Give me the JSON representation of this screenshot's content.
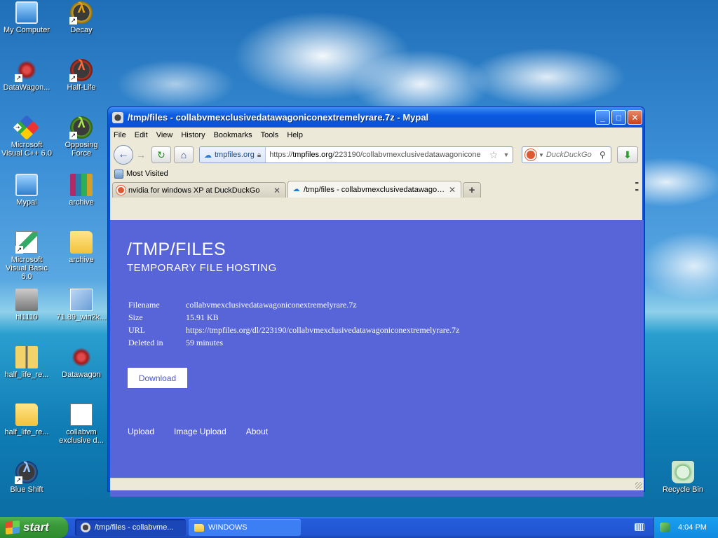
{
  "desktop": {
    "icons": [
      {
        "label": "My Computer"
      },
      {
        "label": "Decay"
      },
      {
        "label": "DataWagon..."
      },
      {
        "label": "Half-Life"
      },
      {
        "label": "Microsoft Visual C++ 6.0"
      },
      {
        "label": "Opposing Force"
      },
      {
        "label": "Mypal"
      },
      {
        "label": "archive"
      },
      {
        "label": "Microsoft Visual Basic 6.0"
      },
      {
        "label": "archive"
      },
      {
        "label": "hl1110"
      },
      {
        "label": "71.89_win2k..."
      },
      {
        "label": "half_life_re..."
      },
      {
        "label": "Datawagon"
      },
      {
        "label": "half_life_re..."
      },
      {
        "label": "collabvm exclusive d..."
      },
      {
        "label": "Blue Shift"
      },
      {
        "label": "Recycle Bin"
      }
    ]
  },
  "window": {
    "title": "/tmp/files - collabvmexclusivedatawagoniconextremelyrare.7z - Mypal",
    "buttons": {
      "minimize": "_",
      "maximize": "□",
      "close": "✕"
    }
  },
  "menubar": {
    "items": [
      "File",
      "Edit",
      "View",
      "History",
      "Bookmarks",
      "Tools",
      "Help"
    ]
  },
  "navbar": {
    "identity_domain": "tmpfiles.org",
    "url_prefix": "https://",
    "url_host": "tmpfiles.org",
    "url_path": "/223190/collabvmexclusivedatawagonicone",
    "search_placeholder": "DuckDuckGo"
  },
  "bookmarks_bar": {
    "items": [
      "Most Visited"
    ]
  },
  "tabs": [
    {
      "label": "nvidia for windows XP at DuckDuckGo",
      "active": false
    },
    {
      "label": "/tmp/files - collabvmexclusivedatawagoni...",
      "active": true
    }
  ],
  "page": {
    "title": "/TMP/FILES",
    "subtitle": "TEMPORARY FILE HOSTING",
    "file_info": [
      {
        "key": "Filename",
        "value": "collabvmexclusivedatawagoniconextremelyrare.7z"
      },
      {
        "key": "Size",
        "value": "15.91 KB"
      },
      {
        "key": "URL",
        "value": "https://tmpfiles.org/dl/223190/collabvmexclusivedatawagoniconextremelyrare.7z"
      },
      {
        "key": "Deleted in",
        "value": "59 minutes"
      }
    ],
    "download_label": "Download",
    "footer_links": [
      "Upload",
      "Image Upload",
      "About"
    ],
    "background_color": "#5865d8"
  },
  "taskbar": {
    "start_label": "start",
    "tasks": [
      {
        "label": "/tmp/files - collabvme...",
        "active": true
      },
      {
        "label": "WINDOWS",
        "active": false
      }
    ],
    "clock": "4:04 PM"
  }
}
